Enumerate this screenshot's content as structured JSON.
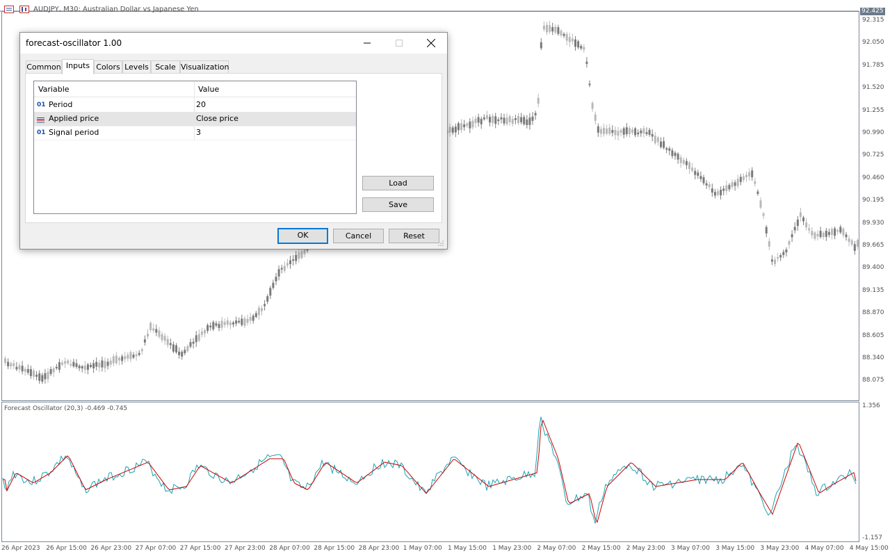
{
  "chart": {
    "title": "AUDJPY, M30:  Australian Dollar vs Japanese Yen",
    "current_price": "92.425",
    "price_levels": [
      "92.315",
      "92.050",
      "91.785",
      "91.520",
      "91.255",
      "90.990",
      "90.725",
      "90.460",
      "90.195",
      "89.930",
      "89.665",
      "89.400",
      "89.135",
      "88.870",
      "88.605",
      "88.340",
      "88.075"
    ],
    "time_labels": [
      "26 Apr 2023",
      "26 Apr 15:00",
      "26 Apr 23:00",
      "27 Apr 07:00",
      "27 Apr 15:00",
      "27 Apr 23:00",
      "28 Apr 07:00",
      "28 Apr 15:00",
      "28 Apr 23:00",
      "1 May 07:00",
      "1 May 15:00",
      "1 May 23:00",
      "2 May 07:00",
      "2 May 15:00",
      "2 May 23:00",
      "3 May 07:00",
      "3 May 15:00",
      "3 May 23:00",
      "4 May 07:00",
      "4 May 15:00"
    ],
    "indicator_title": "Forecast Oscillator (20,3) -0.469 -0.745",
    "indicator_max": "1.356",
    "indicator_min": "-1.157",
    "colors": {
      "bull": "#b8b8b8",
      "bear": "#7a7a7a",
      "main_line": "#19a3b3",
      "signal_line": "#cc0000",
      "grid": "#7a8898"
    }
  },
  "dialog": {
    "title": "forecast-oscillator 1.00",
    "tabs": [
      "Common",
      "Inputs",
      "Colors",
      "Levels",
      "Scale",
      "Visualization"
    ],
    "active_tab": "Inputs",
    "grid_headers": {
      "variable": "Variable",
      "value": "Value"
    },
    "rows": [
      {
        "icon": "01",
        "variable": "Period",
        "value": "20"
      },
      {
        "icon": "list",
        "variable": "Applied price",
        "value": "Close price"
      },
      {
        "icon": "01",
        "variable": "Signal period",
        "value": "3"
      }
    ],
    "buttons": {
      "load": "Load",
      "save": "Save",
      "ok": "OK",
      "cancel": "Cancel",
      "reset": "Reset"
    }
  }
}
